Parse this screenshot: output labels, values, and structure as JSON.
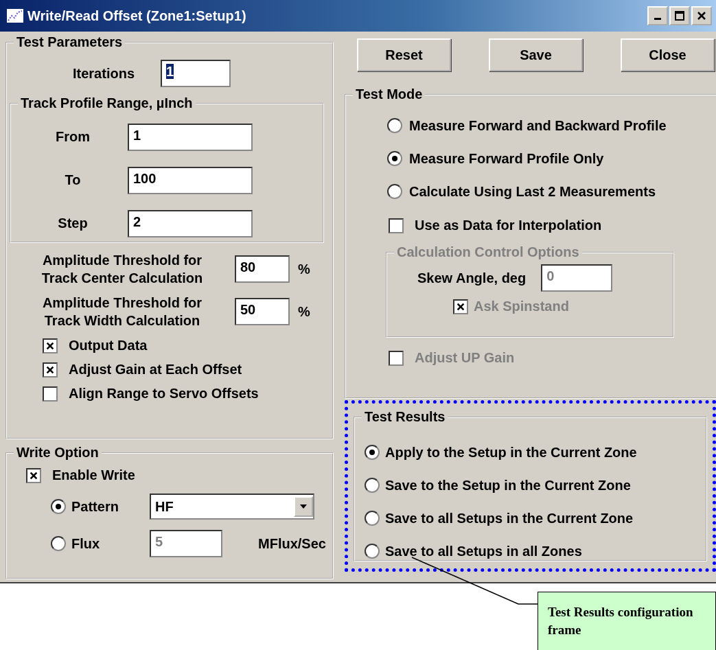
{
  "window": {
    "title": "Write/Read Offset (Zone1:Setup1)"
  },
  "test_parameters": {
    "title": "Test Parameters",
    "iterations": {
      "label": "Iterations",
      "value": "1",
      "text_selected": true
    },
    "track_profile_range": {
      "title": "Track Profile Range, µInch",
      "fields": [
        {
          "label": "From",
          "value": "1"
        },
        {
          "label": "To",
          "value": "100"
        },
        {
          "label": "Step",
          "value": "2"
        }
      ]
    },
    "thresholds": [
      {
        "label_lines": [
          "Amplitude Threshold for",
          "Track Center Calculation"
        ],
        "value": "80",
        "unit": "%"
      },
      {
        "label_lines": [
          "Amplitude Threshold for",
          "Track Width Calculation"
        ],
        "value": "50",
        "unit": "%"
      }
    ],
    "options": [
      {
        "label": "Output Data",
        "checked": true
      },
      {
        "label": "Adjust Gain at Each Offset",
        "checked": true
      },
      {
        "label": "Align Range to Servo Offsets",
        "checked": false
      }
    ]
  },
  "write_option": {
    "title": "Write Option",
    "enable": {
      "label": "Enable Write",
      "checked": true
    },
    "modes": [
      {
        "kind": "dropdown",
        "label": "Pattern",
        "selected": true,
        "value": "HF",
        "disabled": false
      },
      {
        "kind": "field",
        "label": "Flux",
        "selected": false,
        "value": "5",
        "disabled": true,
        "unit": "MFlux/Sec"
      }
    ]
  },
  "buttons": [
    "Reset",
    "Save",
    "Close"
  ],
  "test_mode": {
    "title": "Test Mode",
    "modes": [
      {
        "label": "Measure Forward and Backward Profile",
        "selected": false
      },
      {
        "label": "Measure Forward Profile Only",
        "selected": true
      },
      {
        "label": "Calculate Using Last 2 Measurements",
        "selected": false
      }
    ],
    "interpolation": {
      "label": "Use as Data for Interpolation",
      "checked": false
    },
    "calc_options": {
      "title": "Calculation Control Options",
      "disabled": true,
      "skew": {
        "label": "Skew Angle, deg",
        "value": "0"
      },
      "ask": {
        "label": "Ask Spinstand",
        "checked": true
      }
    },
    "adjust_up_gain": {
      "label": "Adjust UP Gain",
      "checked": false,
      "disabled": true
    }
  },
  "test_results": {
    "title": "Test Results",
    "highlighted": true,
    "options": [
      {
        "label": "Apply to the Setup in the Current Zone",
        "selected": true
      },
      {
        "label": "Save to the Setup in the Current Zone",
        "selected": false
      },
      {
        "label": "Save to all Setups in the Current Zone",
        "selected": false
      },
      {
        "label": "Save to all Setups in all Zones",
        "selected": false
      }
    ]
  },
  "callout": {
    "text": "Test Results configuration frame"
  }
}
